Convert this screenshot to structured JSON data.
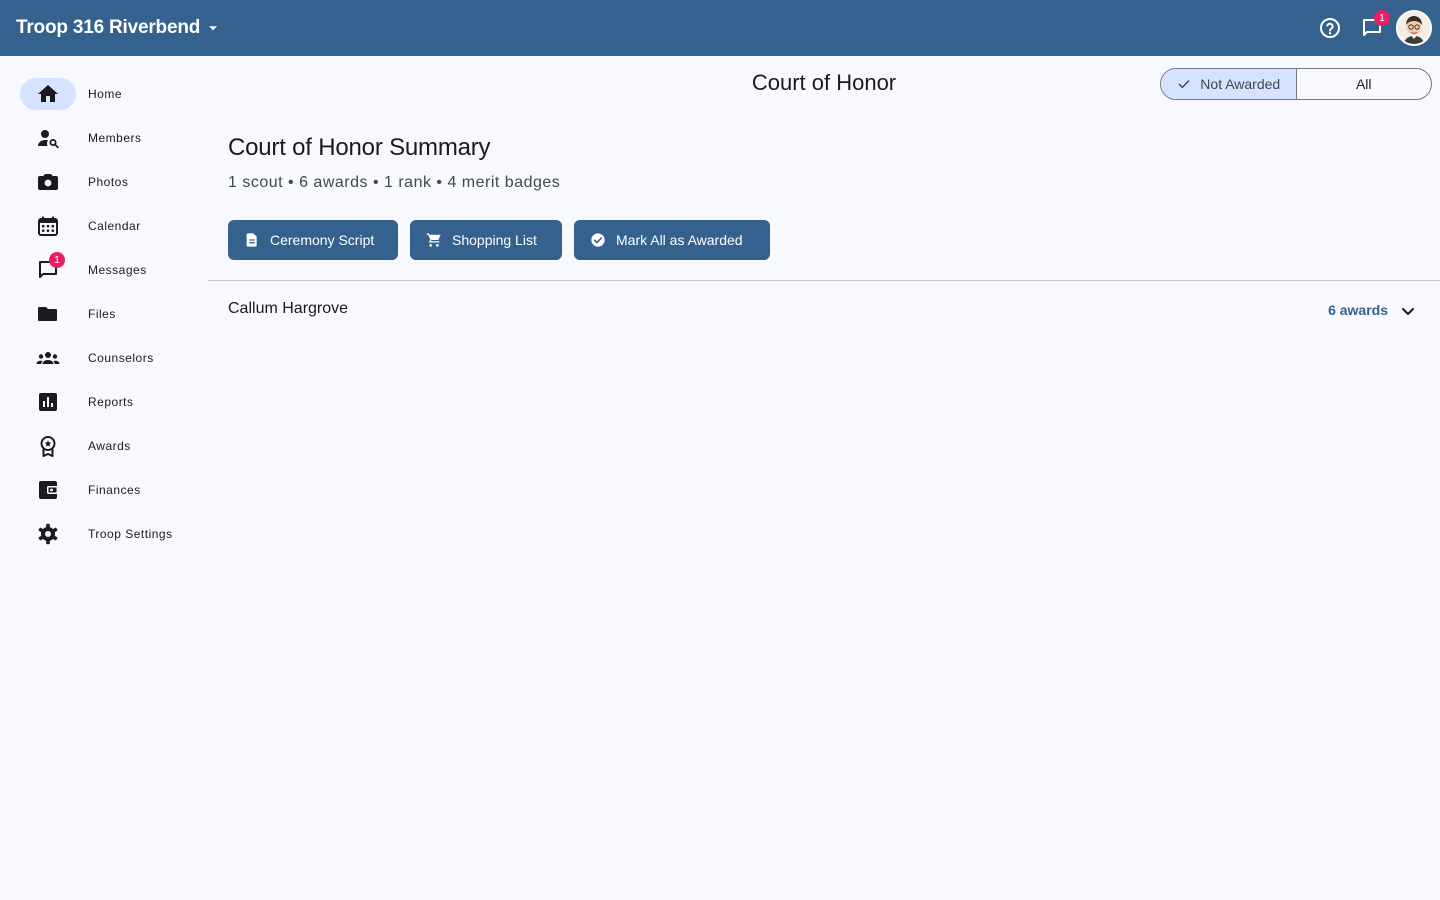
{
  "header": {
    "troop_name": "Troop 316 Riverbend",
    "messages_badge": "1",
    "brand_color": "#34618e"
  },
  "sidebar": {
    "items": [
      {
        "label": "Home",
        "icon": "home-icon",
        "active": true
      },
      {
        "label": "Members",
        "icon": "person-search-icon"
      },
      {
        "label": "Photos",
        "icon": "camera-icon"
      },
      {
        "label": "Calendar",
        "icon": "calendar-icon"
      },
      {
        "label": "Messages",
        "icon": "chat-icon",
        "badge": "1"
      },
      {
        "label": "Files",
        "icon": "folder-icon"
      },
      {
        "label": "Counselors",
        "icon": "groups-icon"
      },
      {
        "label": "Reports",
        "icon": "bar-chart-icon"
      },
      {
        "label": "Awards",
        "icon": "award-icon"
      },
      {
        "label": "Finances",
        "icon": "wallet-icon"
      },
      {
        "label": "Troop Settings",
        "icon": "gear-icon"
      }
    ]
  },
  "page": {
    "title": "Court of Honor",
    "filter": {
      "options": [
        "Not Awarded",
        "All"
      ],
      "selected": "Not Awarded"
    }
  },
  "summary": {
    "title": "Court of Honor Summary",
    "subtitle": "1 scout • 6 awards • 1 rank • 4 merit badges",
    "actions": {
      "ceremony_script": "Ceremony Script",
      "shopping_list": "Shopping List",
      "mark_all": "Mark All as Awarded"
    }
  },
  "scouts": [
    {
      "name": "Callum Hargrove",
      "awards_label": "6 awards"
    }
  ]
}
